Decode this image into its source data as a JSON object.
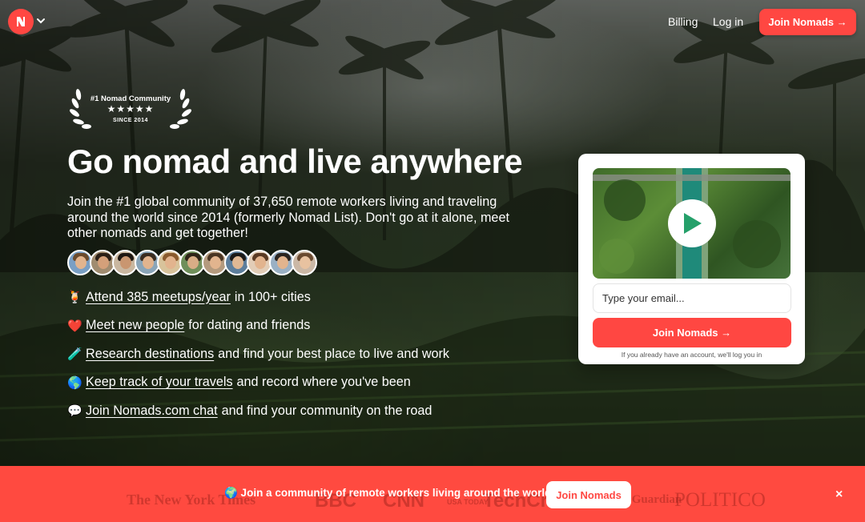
{
  "nav": {
    "billing": "Billing",
    "login": "Log in",
    "join": "Join Nomads →"
  },
  "badge": {
    "title": "#1 Nomad Community",
    "stars": "★★★★★",
    "since": "SINCE 2014"
  },
  "hero": {
    "headline": "Go nomad and live anywhere",
    "subtitle": "Join the #1 global community of 37,650 remote workers living and traveling around the world since 2014 (formerly Nomad List). Don't go at it alone, meet other nomads and get together!",
    "member_avatar_count": 11,
    "features": [
      {
        "emoji": "🍹",
        "link": "Attend 385 meetups/year",
        "text": "in 100+ cities"
      },
      {
        "emoji": "❤️",
        "link": "Meet new people",
        "text": "for dating and friends"
      },
      {
        "emoji": "🧪",
        "link": "Research destinations",
        "text": "and find your best place to live and work"
      },
      {
        "emoji": "🌎",
        "link": "Keep track of your travels",
        "text": "and record where you've been"
      },
      {
        "emoji": "💬",
        "link": "Join Nomads.com chat",
        "text": "and find your community on the road"
      }
    ]
  },
  "signup": {
    "email_placeholder": "Type your email...",
    "join_label": "Join Nomads →",
    "note": "If you already have an account, we'll log you in"
  },
  "banner": {
    "text": "🌍 Join a community of remote workers living around the world",
    "join_label": "Join Nomads",
    "close": "×",
    "press_logos": [
      "The New York Times",
      "BBC",
      "CNN",
      "USA TODAY",
      "TechCrunch",
      "The Guardian",
      "POLITICO"
    ]
  },
  "colors": {
    "brand_red": "#ff4742",
    "white": "#ffffff"
  }
}
